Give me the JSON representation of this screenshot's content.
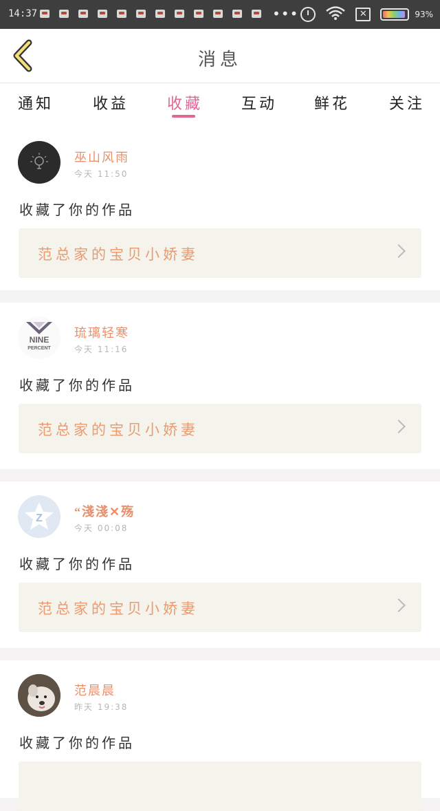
{
  "status_bar": {
    "time": "14:37",
    "more": "•••",
    "battery_text": "93%",
    "battery_level": 0.93
  },
  "header": {
    "title": "消息"
  },
  "tabs": [
    {
      "label": "通知"
    },
    {
      "label": "收益"
    },
    {
      "label": "收藏"
    },
    {
      "label": "互动"
    },
    {
      "label": "鲜花"
    },
    {
      "label": "关注"
    }
  ],
  "active_tab": "收藏",
  "notifications": [
    {
      "user": "巫山风雨",
      "time": "今天 11:50",
      "action": "收藏了你的作品",
      "work": "范总家的宝贝小娇妻",
      "avatar": "lightbulb-avatar"
    },
    {
      "user": "琉璃轻寒",
      "time": "今天 11:16",
      "action": "收藏了你的作品",
      "work": "范总家的宝贝小娇妻",
      "avatar": "nine-percent-avatar"
    },
    {
      "user": "“淺淺✕殇",
      "time": "今天 00:08",
      "action": "收藏了你的作品",
      "work": "范总家的宝贝小娇妻",
      "avatar": "default-z-avatar"
    },
    {
      "user": "范晨晨",
      "time": "昨天 19:38",
      "action": "收藏了你的作品",
      "work": "",
      "avatar": "dog-avatar"
    }
  ],
  "colors": {
    "accent": "#e06694",
    "username": "#e9906b",
    "work_title": "#ec9a6e",
    "work_bg": "#f4f3ec"
  }
}
